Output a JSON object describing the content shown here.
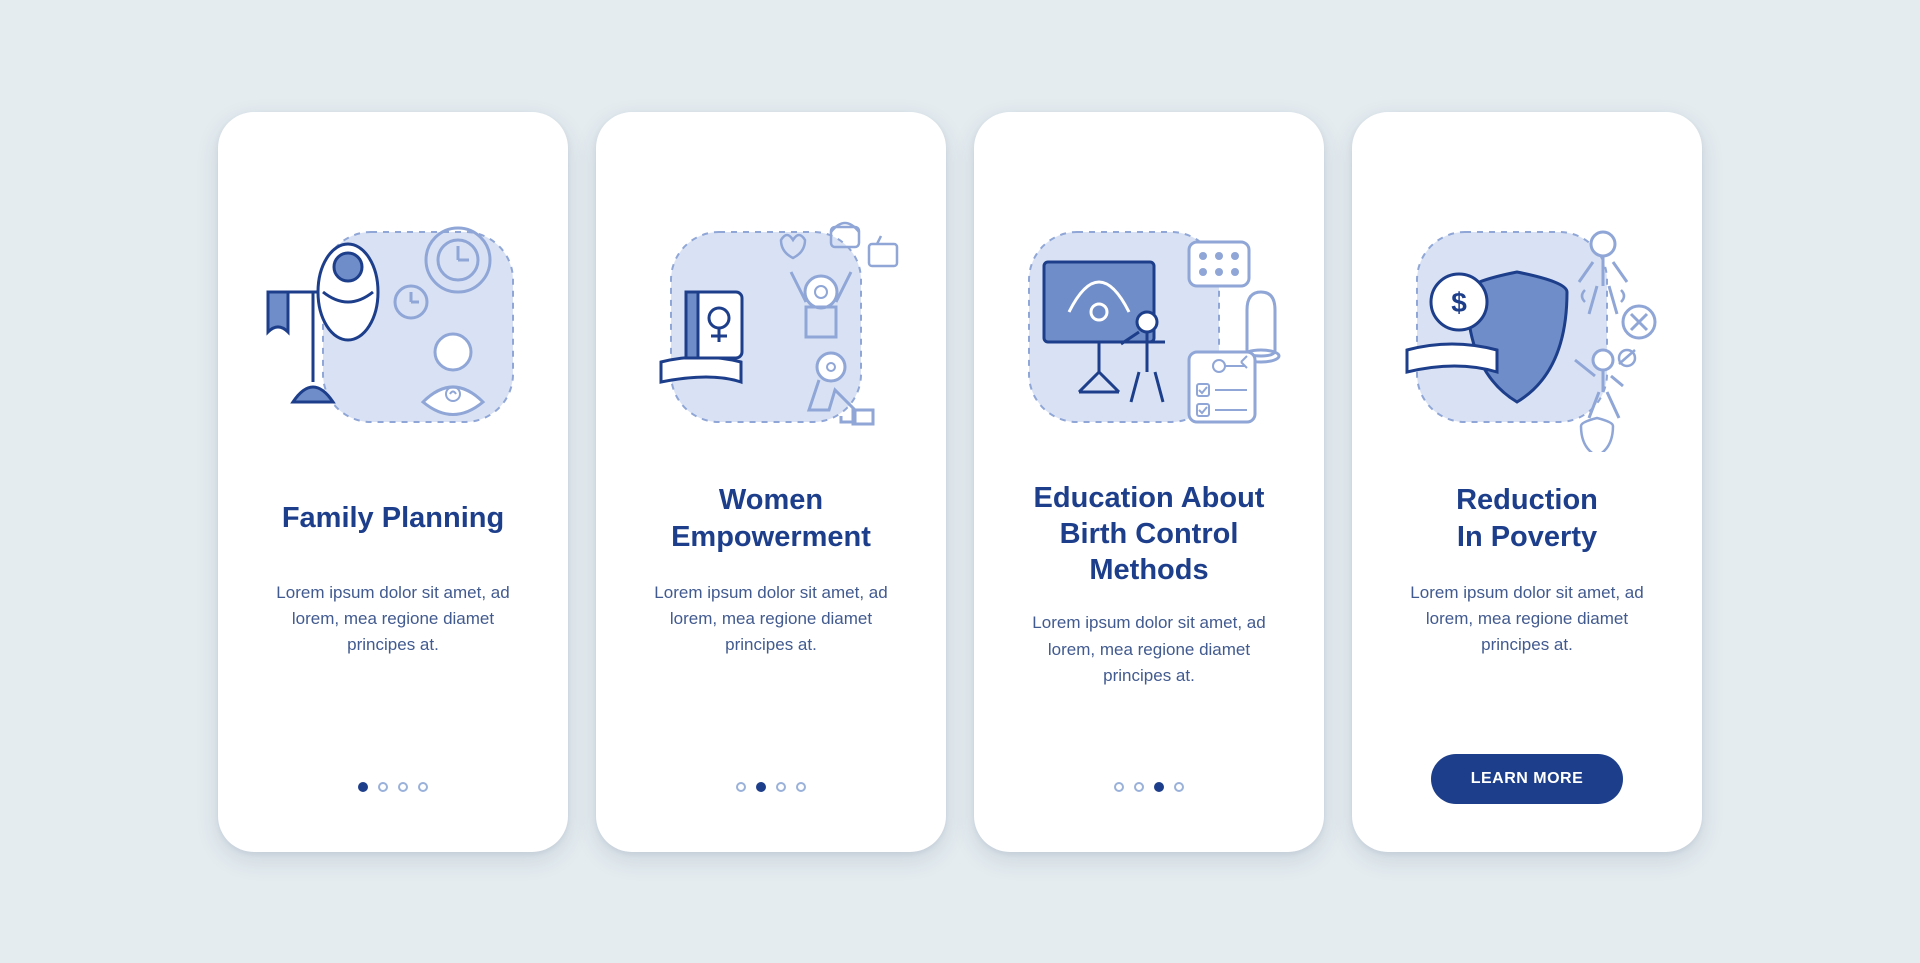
{
  "colors": {
    "primary": "#1d3e8a",
    "light": "#9ab1da",
    "bg_shape": "#d9e2f5"
  },
  "cards": [
    {
      "title": "Family Planning",
      "desc": "Lorem ipsum dolor sit amet, ad lorem, mea regione diamet principes at.",
      "active_dot": 0,
      "has_button": false
    },
    {
      "title": "Women\nEmpowerment",
      "desc": "Lorem ipsum dolor sit amet, ad lorem, mea regione diamet principes at.",
      "active_dot": 1,
      "has_button": false
    },
    {
      "title": "Education About\nBirth Control Methods",
      "desc": "Lorem ipsum dolor sit amet, ad lorem, mea regione diamet principes at.",
      "active_dot": 2,
      "has_button": false
    },
    {
      "title": "Reduction\nIn Poverty",
      "desc": "Lorem ipsum dolor sit amet, ad lorem, mea regione diamet principes at.",
      "active_dot": 3,
      "has_button": true
    }
  ],
  "button_label": "LEARN MORE",
  "dot_count": 4
}
